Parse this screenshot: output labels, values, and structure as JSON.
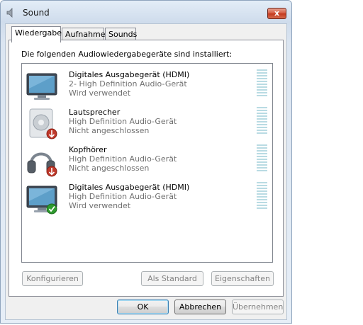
{
  "window": {
    "title": "Sound",
    "close_label": "x",
    "title_icon": "speaker-icon"
  },
  "tabs": [
    {
      "label": "Wiedergabe",
      "active": true
    },
    {
      "label": "Aufnahme",
      "active": false
    },
    {
      "label": "Sounds",
      "active": false
    }
  ],
  "playback": {
    "intro": "Die folgenden Audiowiedergabegeräte sind installiert:",
    "devices": [
      {
        "name": "Digitales Ausgabegerät (HDMI)",
        "driver": "2- High Definition Audio-Gerät",
        "status": "Wird verwendet",
        "icon": "monitor-icon",
        "badge": "none"
      },
      {
        "name": "Lautsprecher",
        "driver": "High Definition Audio-Gerät",
        "status": "Nicht angeschlossen",
        "icon": "speaker-icon",
        "badge": "disconnected-down-arrow-icon"
      },
      {
        "name": "Kopfhörer",
        "driver": "High Definition Audio-Gerät",
        "status": "Nicht angeschlossen",
        "icon": "headphones-icon",
        "badge": "disconnected-down-arrow-icon"
      },
      {
        "name": "Digitales Ausgabegerät (HDMI)",
        "driver": "High Definition Audio-Gerät",
        "status": "Wird verwendet",
        "icon": "monitor-icon",
        "badge": "default-checkmark-icon"
      }
    ],
    "buttons": {
      "configure": "Konfigurieren",
      "set_default": "Als Standard",
      "properties": "Eigenschaften"
    }
  },
  "footer": {
    "ok": "OK",
    "cancel": "Abbrechen",
    "apply": "Übernehmen"
  },
  "colors": {
    "meter": "#b9dbe3",
    "badge_red": "#c0392b",
    "badge_green": "#2e9a2e"
  }
}
